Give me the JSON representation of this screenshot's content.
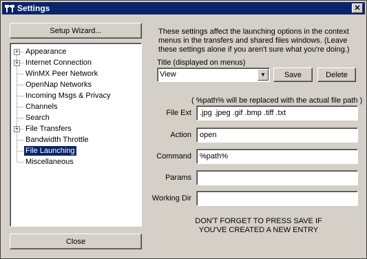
{
  "window": {
    "title": "Settings",
    "close_glyph": "✕"
  },
  "left": {
    "setup_wizard": "Setup Wizard...",
    "close": "Close",
    "tree": [
      {
        "label": "Appearance",
        "expander": "+"
      },
      {
        "label": "Internet Connection",
        "expander": "+"
      },
      {
        "label": "WinMX Peer Network",
        "expander": ""
      },
      {
        "label": "OpenNap Networks",
        "expander": ""
      },
      {
        "label": "Incoming Msgs & Privacy",
        "expander": ""
      },
      {
        "label": "Channels",
        "expander": ""
      },
      {
        "label": "Search",
        "expander": ""
      },
      {
        "label": "File Transfers",
        "expander": "+"
      },
      {
        "label": "Bandwidth Throttle",
        "expander": ""
      },
      {
        "label": "File Launching",
        "expander": "",
        "selected": true
      },
      {
        "label": "Miscellaneous",
        "expander": ""
      }
    ]
  },
  "right": {
    "intro": [
      "These settings affect the launching options in the context",
      "menus in the transfers and shared files windows.  (Leave",
      "these settings alone if you aren't sure what you're doing.)"
    ],
    "title_label": "Title (displayed on menus)",
    "title_value": "View",
    "save": "Save",
    "delete": "Delete",
    "note": "( %path% will be replaced with the actual file path )",
    "fields": [
      {
        "label": "File Ext",
        "value": ".jpg .jpeg .gif .bmp .tiff .txt"
      },
      {
        "label": "Action",
        "value": "open"
      },
      {
        "label": "Command",
        "value": "%path%"
      },
      {
        "label": "Params",
        "value": ""
      },
      {
        "label": "Working Dir",
        "value": ""
      }
    ],
    "warning": [
      "DON'T FORGET TO PRESS SAVE IF",
      "YOU'VE CREATED A NEW ENTRY"
    ]
  }
}
